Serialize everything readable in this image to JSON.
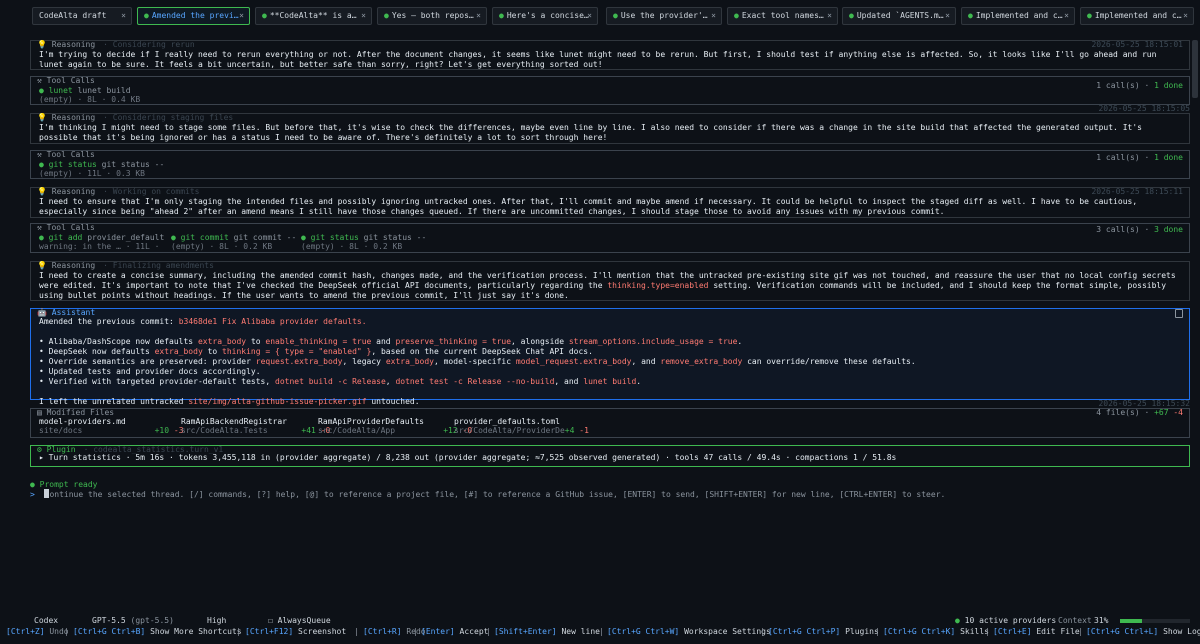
{
  "tabs": [
    {
      "label": "CodeAlta draft",
      "active": false,
      "dot": false
    },
    {
      "label": "Amended the previ…",
      "active": true,
      "dot": true
    },
    {
      "label": "**CodeAlta** is a…",
      "active": false,
      "dot": true
    },
    {
      "label": "Yes — both repos…",
      "active": false,
      "dot": true
    },
    {
      "label": "Here's a concise…",
      "active": false,
      "dot": true
    },
    {
      "label": "Use the provider'…",
      "active": false,
      "dot": true
    },
    {
      "label": "Exact tool names…",
      "active": false,
      "dot": true
    },
    {
      "label": "Updated `AGENTS.m…",
      "active": false,
      "dot": true
    },
    {
      "label": "Implemented and c…",
      "active": false,
      "dot": true
    },
    {
      "label": "Implemented and c…",
      "active": false,
      "dot": true
    }
  ],
  "tab_close": "×",
  "reason_label": "Reasoning",
  "tools_label": "Tool Calls",
  "r1": {
    "sub": "· Considering rerun",
    "ts": "2026-05-25 18:15:01",
    "text": "I'm trying to decide if I really need to rerun everything or not. After the document changes, it seems like lunet might need to be rerun. But first, I should test if anything else is affected. So, it looks like I'll go ahead and run lunet again to be sure. It feels a bit uncertain, but better safe than sorry, right? Let's get everything sorted out!"
  },
  "t1": {
    "ts": "2026-05-25 18:15:05",
    "summary_pre": "1 call(s) · ",
    "summary_done": "1 done",
    "calls": [
      {
        "name": "lunet",
        "args": "lunet build",
        "meta": "(empty) · 8L · 0.4 KB"
      }
    ]
  },
  "r2": {
    "sub": "· Considering staging files",
    "ts": "2026-05-25 18:15:05",
    "text": "I'm thinking I might need to stage some files. But before that, it's wise to check the differences, maybe even line by line. I also need to consider if there was a change in the site build that affected the generated output. It's possible that it's being ignored or has a status I need to be aware of. There's definitely a lot to sort through here!"
  },
  "t2": {
    "ts": "2026-05-25 18:15:11",
    "summary_pre": "1 call(s) · ",
    "summary_done": "1 done",
    "calls": [
      {
        "name": "git status",
        "args": "git status --",
        "meta": "(empty) · 11L · 0.3 KB"
      }
    ]
  },
  "r3": {
    "sub": "· Working on commits",
    "ts": "2026-05-25 18:15:11",
    "text": "I need to ensure that I'm only staging the intended files and possibly ignoring untracked ones. After that, I'll commit and maybe amend if necessary. It could be helpful to inspect the staged diff as well. I have to be cautious, especially since being \"ahead 2\" after an amend means I still have those changes queued. If there are uncommitted changes, I should stage those to avoid any issues with my previous commit."
  },
  "t3": {
    "ts": "2026-05-25 18:15:16",
    "summary_pre": "3 call(s) · ",
    "summary_done": "3 done",
    "calls": [
      {
        "name": "git add",
        "args": "provider_default",
        "meta": "warning: in the … · 11L ·"
      },
      {
        "name": "git commit",
        "args": "git commit --",
        "meta": "(empty) · 8L · 0.2 KB"
      },
      {
        "name": "git status",
        "args": "git status --",
        "meta": "(empty) · 8L · 0.2 KB"
      }
    ]
  },
  "r4": {
    "sub": "· Finalizing amendments",
    "ts": "2026-05-25 18:15:20",
    "text_a": "I need to create a concise summary, including the amended commit hash, changes made, and the verification process. I'll mention that the untracked pre-existing site gif was not touched, and reassure the user that no local config secrets were edited. It's important to note that I've checked the DeepSeek official API documents, particularly regarding the ",
    "text_hl": "thinking.type=enabled",
    "text_b": " setting. Verification commands will be included, and I should keep the format simple, possibly using bullet points without headings. If the user wants to amend the previous commit, I'll just say it's done."
  },
  "assistant": {
    "label": "Assistant",
    "ts": "2026-05-25 18:15:32",
    "l1_pre": "Amended the previous commit: ",
    "l1_hash": "b3468de1 Fix Alibaba provider defaults.",
    "b1": [
      "• Alibaba/DashScope now defaults ",
      "extra_body",
      " to ",
      "enable_thinking = true",
      " and ",
      "preserve_thinking = true",
      ", alongside ",
      "stream_options.include_usage = true",
      "."
    ],
    "b2": [
      "• DeepSeek now defaults ",
      "extra_body",
      " to ",
      "thinking = { type = \"enabled\" }",
      ", based on the current DeepSeek Chat API docs."
    ],
    "b3": [
      "• Override semantics are preserved: provider ",
      "request.extra_body",
      ", legacy ",
      "extra_body",
      ", model-specific ",
      "model_request.extra_body",
      ", and ",
      "remove_extra_body",
      " can override/remove these defaults."
    ],
    "b4": "• Updated tests and provider docs accordingly.",
    "b5": [
      "• Verified with targeted provider-default tests, ",
      "dotnet build -c Release",
      ", ",
      "dotnet test -c Release --no-build",
      ", and ",
      "lunet build",
      "."
    ],
    "l_end": [
      "I left the unrelated untracked ",
      "site/img/alta-github-issue-picker.gif",
      " untouched."
    ]
  },
  "files": {
    "label": "Modified Files",
    "ts": "2026-05-25 18:15:32",
    "summary_pre": "4 file(s) · ",
    "add": "+67",
    "del": "-4",
    "items": [
      {
        "name": "model-providers.md",
        "path": "site/docs",
        "add": "+10",
        "del": "-3"
      },
      {
        "name": "RamApiBackendRegistrar",
        "path": "src/CodeAlta.Tests",
        "add": "+41",
        "del": "-0"
      },
      {
        "name": "RamApiProviderDefaults",
        "path": "src/CodeAlta/App",
        "add": "+12",
        "del": "-0"
      },
      {
        "name": "provider_defaults.toml",
        "path": "src/CodeAlta/ProviderDe",
        "add": "+4",
        "del": "-1"
      }
    ]
  },
  "plugin": {
    "label": "Plugin",
    "sub": "· codealta_statistics.turn_v1",
    "ts": "2026-05-25 18:15:32",
    "text": "▸ Turn statistics · 5m 16s · tokens 3,455,118 in (provider aggregate) / 8,238 out (provider aggregate; ≈7,525 observed generated) · tools 47 calls / 49.4s · compactions 1 / 51.8s"
  },
  "prompt": {
    "ready": "Prompt ready",
    "caret": ">",
    "placeholder": "ontinue the selected thread. [/] commands, [?] help, [@] to reference a project file, [#] to reference a GitHub issue, [ENTER] to send, [SHIFT+ENTER] for new line, [CTRL+ENTER] to steer."
  },
  "status": {
    "agent": "Codex",
    "model": "GPT-5.5",
    "model_id": "(gpt-5.5)",
    "effort": "High",
    "queue": "AlwaysQueue",
    "providers": "10 active providers",
    "context_label": "Context",
    "context": "31%",
    "colors": {
      "accent": "#58a6ff",
      "ok": "#3fb950",
      "warn": "#ff7b72"
    }
  },
  "shortcuts": [
    {
      "k": "[Ctrl+Z]",
      "l": "Undo"
    },
    {
      "k": "[Ctrl+G Ctrl+B]",
      "l": "Show More Shortcuts"
    },
    {
      "k": "[Ctrl+F12]",
      "l": "Screenshot"
    },
    {
      "k": "[Ctrl+R]",
      "l": "Redo"
    },
    {
      "k": "[Enter]",
      "l": "Accept"
    },
    {
      "k": "[Shift+Enter]",
      "l": "New line"
    },
    {
      "k": "[Ctrl+G Ctrl+W]",
      "l": "Workspace Settings"
    },
    {
      "k": "[Ctrl+G Ctrl+P]",
      "l": "Plugins"
    },
    {
      "k": "[Ctrl+G Ctrl+K]",
      "l": "Skills"
    },
    {
      "k": "[Ctrl+E]",
      "l": "Edit File"
    },
    {
      "k": "[Ctrl+G Ctrl+L]",
      "l": "Show Logs"
    }
  ]
}
